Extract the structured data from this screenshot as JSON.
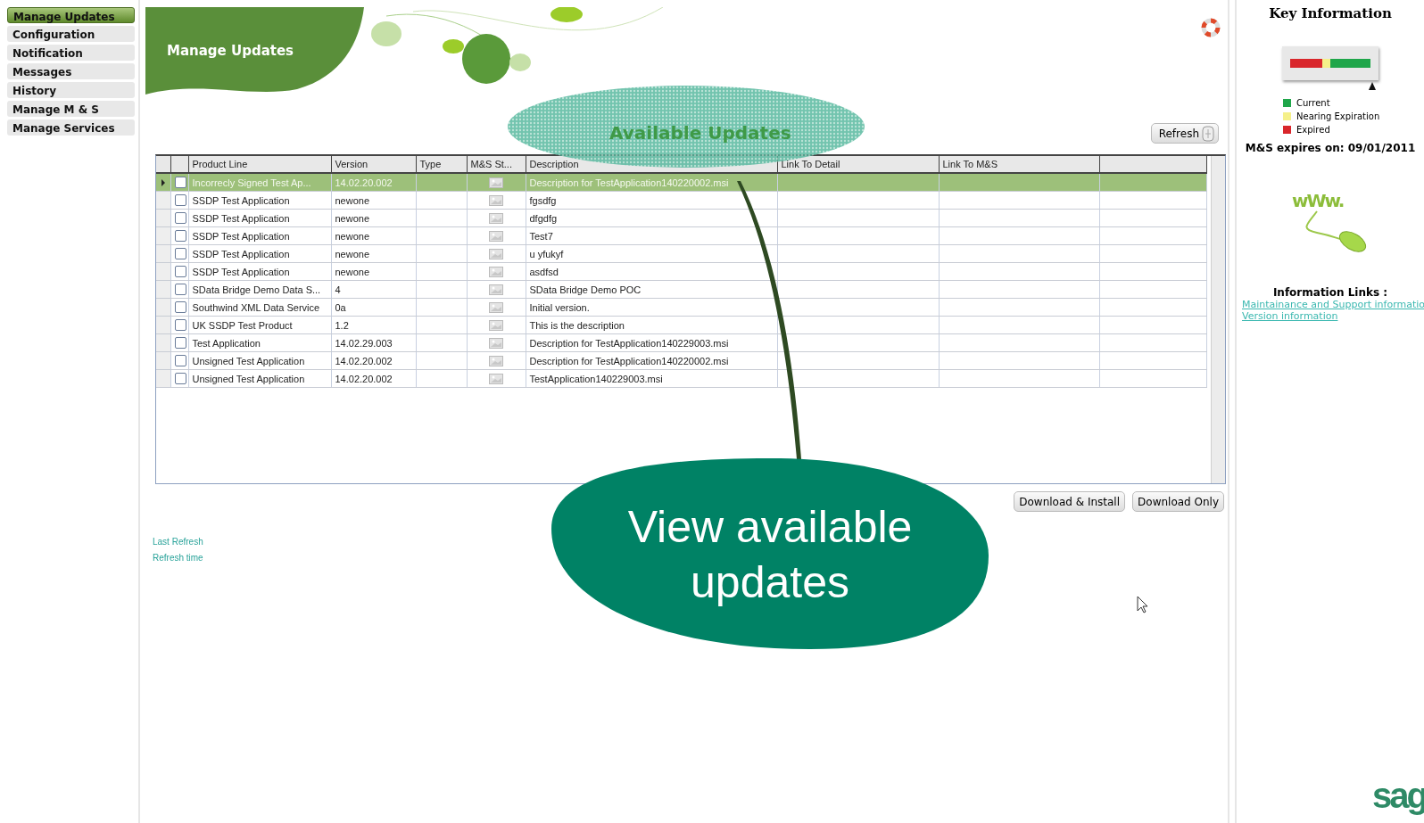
{
  "sidebar": {
    "items": [
      {
        "label": "Manage Updates",
        "selected": true
      },
      {
        "label": "Configuration",
        "selected": false
      },
      {
        "label": "Notification",
        "selected": false
      },
      {
        "label": "Messages",
        "selected": false
      },
      {
        "label": "History",
        "selected": false
      },
      {
        "label": "Manage M & S",
        "selected": false
      },
      {
        "label": "Manage Services",
        "selected": false
      }
    ]
  },
  "header": {
    "title": "Manage Updates"
  },
  "callouts": [
    {
      "kind": "pattern",
      "text": "Available Updates"
    },
    {
      "kind": "solid",
      "text": "View available updates"
    }
  ],
  "refresh_button": "Refresh",
  "table": {
    "columns": [
      "Product Line",
      "Version",
      "Type",
      "M&S St...",
      "Description",
      "Link To Detail",
      "Link To M&S"
    ],
    "rows": [
      {
        "product_line": "Incorrecly Signed Test Ap...",
        "version": "14.02.20.002",
        "description": "Description for TestApplication140220002.msi",
        "selected": true,
        "checked": false
      },
      {
        "product_line": "SSDP Test Application",
        "version": "newone",
        "description": "fgsdfg",
        "selected": false,
        "checked": false
      },
      {
        "product_line": "SSDP Test Application",
        "version": "newone",
        "description": "dfgdfg",
        "selected": false,
        "checked": false
      },
      {
        "product_line": "SSDP Test Application",
        "version": "newone",
        "description": "Test7",
        "selected": false,
        "checked": false
      },
      {
        "product_line": "SSDP Test Application",
        "version": "newone",
        "description": "u yfukyf",
        "selected": false,
        "checked": false
      },
      {
        "product_line": "SSDP Test Application",
        "version": "newone",
        "description": "asdfsd",
        "selected": false,
        "checked": false
      },
      {
        "product_line": "SData Bridge Demo Data S...",
        "version": "4",
        "description": "SData Bridge Demo POC",
        "selected": false,
        "checked": false
      },
      {
        "product_line": "Southwind XML Data Service",
        "version": "0a",
        "description": "Initial version.",
        "selected": false,
        "checked": false
      },
      {
        "product_line": "UK SSDP Test Product",
        "version": "1.2",
        "description": "This is the description",
        "selected": false,
        "checked": false
      },
      {
        "product_line": "Test Application",
        "version": "14.02.29.003",
        "description": "Description for TestApplication140229003.msi",
        "selected": false,
        "checked": false
      },
      {
        "product_line": "Unsigned Test Application",
        "version": "14.02.20.002",
        "description": "Description for TestApplication140220002.msi",
        "selected": false,
        "checked": false
      },
      {
        "product_line": "Unsigned Test Application",
        "version": "14.02.20.002",
        "description": "TestApplication140229003.msi",
        "selected": false,
        "checked": false
      }
    ]
  },
  "buttons": [
    "Download & Install",
    "Download Only"
  ],
  "refresh_info": [
    "Last Refresh",
    "Refresh time"
  ],
  "key_info": {
    "title": "Key Information",
    "legend": [
      {
        "label": "Current",
        "color": "#1fa64a"
      },
      {
        "label": "Nearing Expiration",
        "color": "#f5f08a"
      },
      {
        "label": "Expired",
        "color": "#d9262b"
      }
    ],
    "expiry": "M&S expires on: 09/01/2011",
    "www_art": "wWw.",
    "links_title": "Information Links :",
    "links": [
      "Maintainance and Support informatio",
      "Version information"
    ]
  },
  "logo": "sag"
}
